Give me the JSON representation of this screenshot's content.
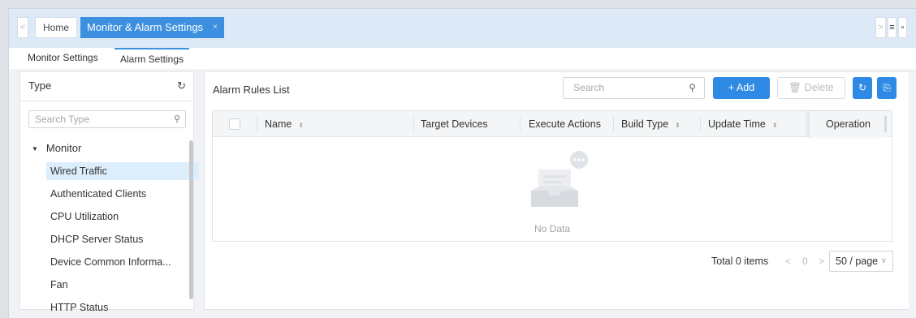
{
  "tabbar": {
    "prev_icon": "chevron-left-icon",
    "next_icon": "chevron-right-icon",
    "menu_icon": "hamburger-icon",
    "trash_icon": "trash-icon",
    "tabs": [
      {
        "label": "Home"
      },
      {
        "label": "Monitor & Alarm Settings",
        "close": "×"
      }
    ]
  },
  "subtabs": [
    {
      "label": "Monitor Settings"
    },
    {
      "label": "Alarm Settings"
    }
  ],
  "type_panel": {
    "title": "Type",
    "refresh_icon": "refresh-icon",
    "search_placeholder": "Search Type",
    "root": "Monitor",
    "items": [
      "Wired Traffic",
      "Authenticated Clients",
      "CPU Utilization",
      "DHCP Server Status",
      "Device Common Informa...",
      "Fan",
      "HTTP Status"
    ],
    "selected_index": 0
  },
  "list_panel": {
    "title": "Alarm Rules List",
    "search_placeholder": "Search",
    "add_label": "+ Add",
    "delete_label": "Delete",
    "columns": [
      "Name",
      "Target Devices",
      "Execute Actions",
      "Build Type",
      "Update Time",
      "Operation"
    ],
    "empty_text": "No Data",
    "pager": {
      "total": "Total 0 items",
      "prev": "<",
      "page": "0",
      "next": ">",
      "page_size": "50 / page"
    }
  },
  "colors": {
    "accent": "#2f8ae5",
    "tab_active": "#3d8fe0",
    "tree_selected": "#dceefc"
  }
}
